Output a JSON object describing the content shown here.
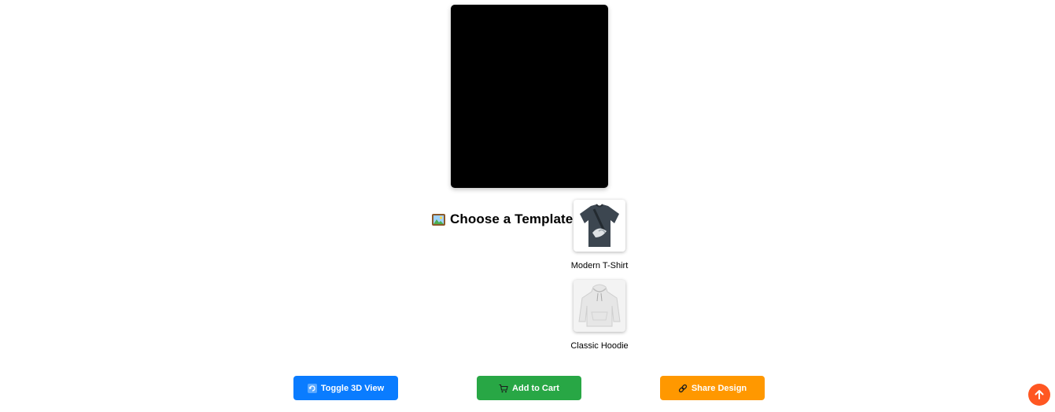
{
  "preview": {
    "background": "#000000"
  },
  "templates_section": {
    "icon": "framed-picture-icon",
    "title": "Choose a Template",
    "items": [
      {
        "label": "Modern T-Shirt",
        "icon": "tshirt-icon",
        "color": "#3c4650"
      },
      {
        "label": "Classic Hoodie",
        "icon": "hoodie-icon",
        "color": "#eeeeee"
      }
    ]
  },
  "actions": {
    "toggle_3d": {
      "label": "Toggle 3D View",
      "icon": "rotate-icon",
      "color": "#0a7cff"
    },
    "add_to_cart": {
      "label": "Add to Cart",
      "icon": "cart-icon",
      "color": "#28a745"
    },
    "share": {
      "label": "Share Design",
      "icon": "link-icon",
      "color": "#ff9800"
    }
  },
  "scroll_top": {
    "icon": "arrow-up-icon",
    "color": "#ff5722"
  }
}
